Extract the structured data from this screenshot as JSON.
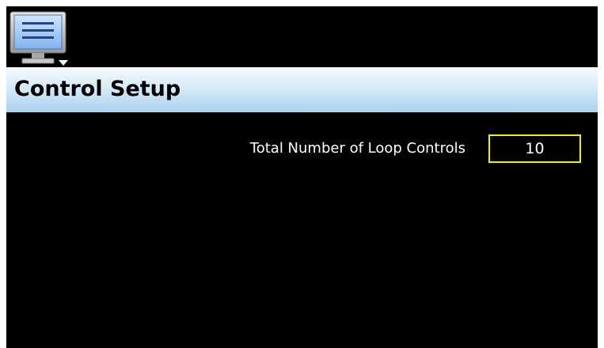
{
  "menu": {
    "icon": "monitor-menu-icon"
  },
  "header": {
    "title": "Control Setup"
  },
  "settings": [
    {
      "label": "Total Number of Loop Controls",
      "value": "10"
    }
  ],
  "colors": {
    "background": "#000000",
    "title_bar_top": "#f4f9fd",
    "title_bar_bottom": "#a9d2ee",
    "field_border": "#f0f000",
    "text": "#ffffff"
  }
}
